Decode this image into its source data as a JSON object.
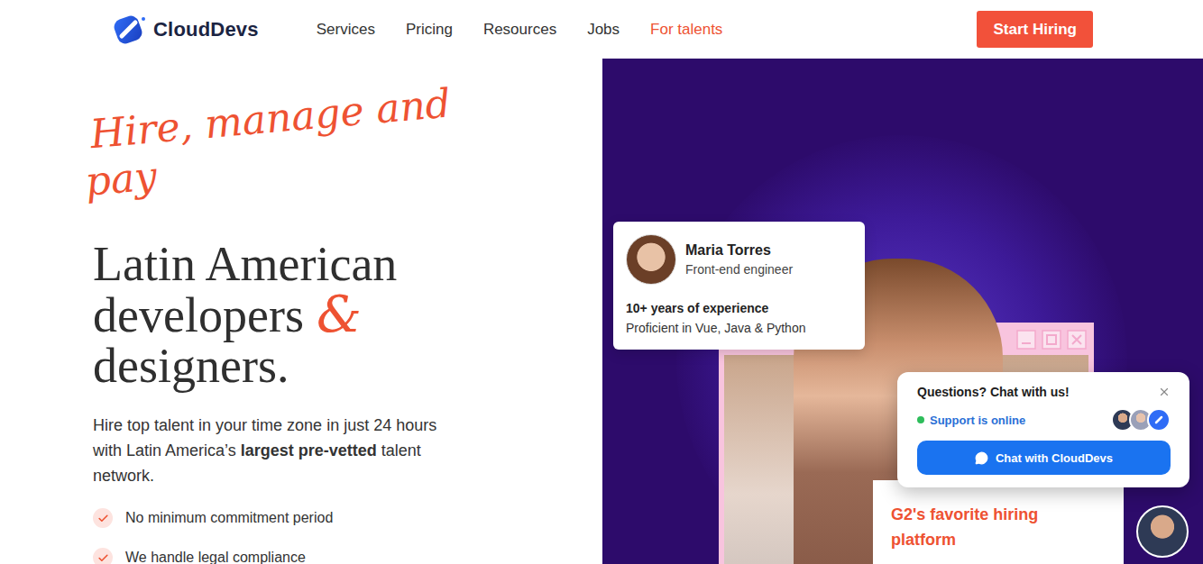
{
  "logo": {
    "text": "CloudDevs"
  },
  "nav": {
    "items": [
      {
        "label": "Services",
        "selected": false
      },
      {
        "label": "Pricing",
        "selected": false
      },
      {
        "label": "Resources",
        "selected": false
      },
      {
        "label": "Jobs",
        "selected": false
      },
      {
        "label": "For talents",
        "selected": true
      }
    ]
  },
  "cta": {
    "label": "Start Hiring"
  },
  "hero": {
    "script_lines": [
      "Hire, manage and",
      "pay"
    ],
    "headline": [
      [
        {
          "text": "Latin American",
          "kind": "serif"
        }
      ],
      [
        {
          "text": "developers",
          "kind": "serif"
        },
        {
          "text": "&",
          "kind": "script"
        }
      ],
      [
        {
          "text": "designers.",
          "kind": "serif"
        }
      ]
    ],
    "subtitle": [
      {
        "text": "Hire top talent in your time zone in just 24 hours with Latin America’s ",
        "bold": false
      },
      {
        "text": "largest pre-vetted",
        "bold": true
      },
      {
        "text": " talent network.",
        "bold": false
      }
    ],
    "checklist": [
      "No minimum commitment period",
      "We handle legal compliance"
    ]
  },
  "profile_card": {
    "name": "Maria Torres",
    "role": "Front-end engineer",
    "experience": "10+ years of experience",
    "skills": "Proficient in Vue, Java & Python"
  },
  "chat": {
    "title": "Questions? Chat with us!",
    "status": "Support is online",
    "online": true,
    "button": "Chat with CloudDevs"
  },
  "g2_card": {
    "text": "G2's favorite hiring platform"
  }
}
